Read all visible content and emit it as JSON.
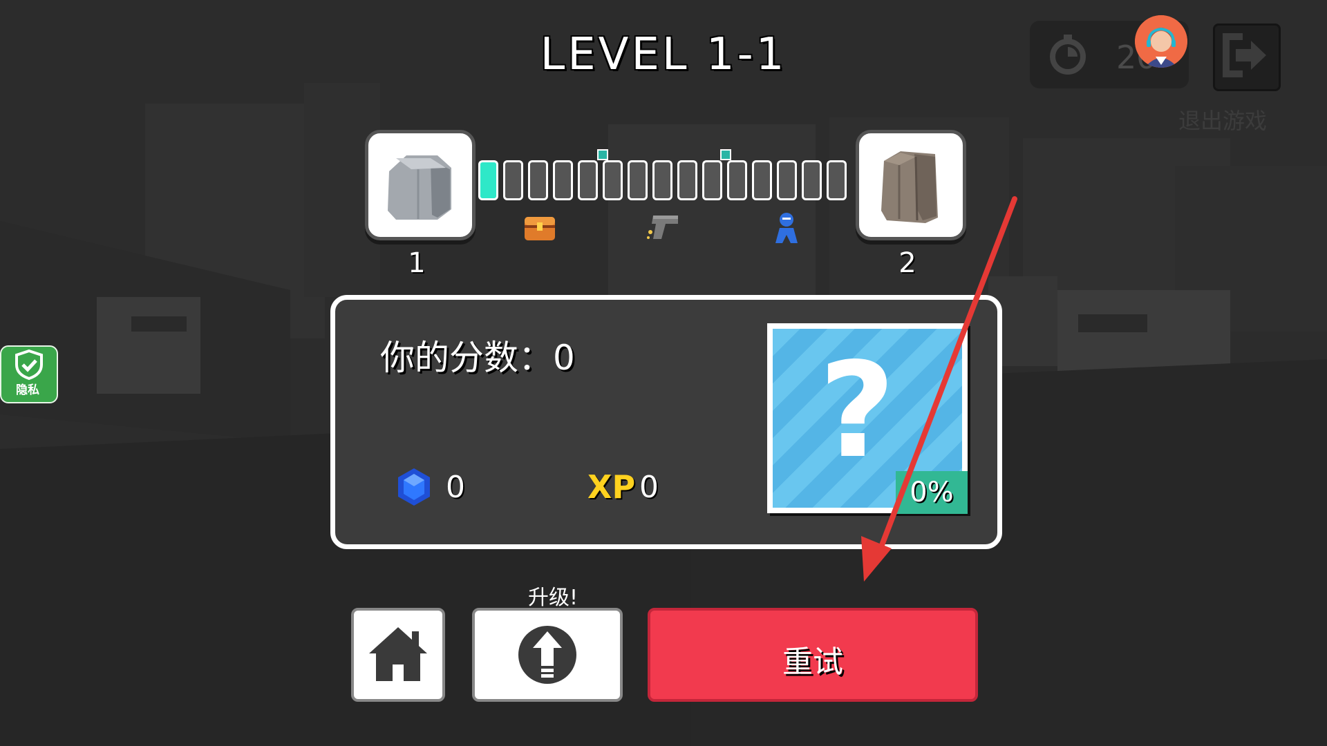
{
  "header": {
    "level_title": "LEVEL 1-1",
    "timer_value": "20",
    "exit_label": "退出游戏"
  },
  "privacy": {
    "label": "隐私"
  },
  "progress": {
    "start_stage": "1",
    "end_stage": "2",
    "segments_total": 15,
    "segments_filled": 1,
    "icons": [
      "treasure-chest-icon",
      "pistol-icon",
      "enemy-figure-icon"
    ]
  },
  "result": {
    "score_label": "你的分数：0",
    "gems": "0",
    "xp_label": "XP",
    "xp": "0",
    "unlock_progress": "0%",
    "mystery_symbol": "?"
  },
  "buttons": {
    "home_icon": "home-icon",
    "upgrade_caption": "升级!",
    "upgrade_icon": "upgrade-arrow-icon",
    "retry_label": "重试"
  },
  "colors": {
    "retry": "#f23a4e",
    "progress_active": "#2ee8c8",
    "privacy": "#3aa64a",
    "unlock_tag": "#32b894",
    "annotation_arrow": "#e53935"
  }
}
